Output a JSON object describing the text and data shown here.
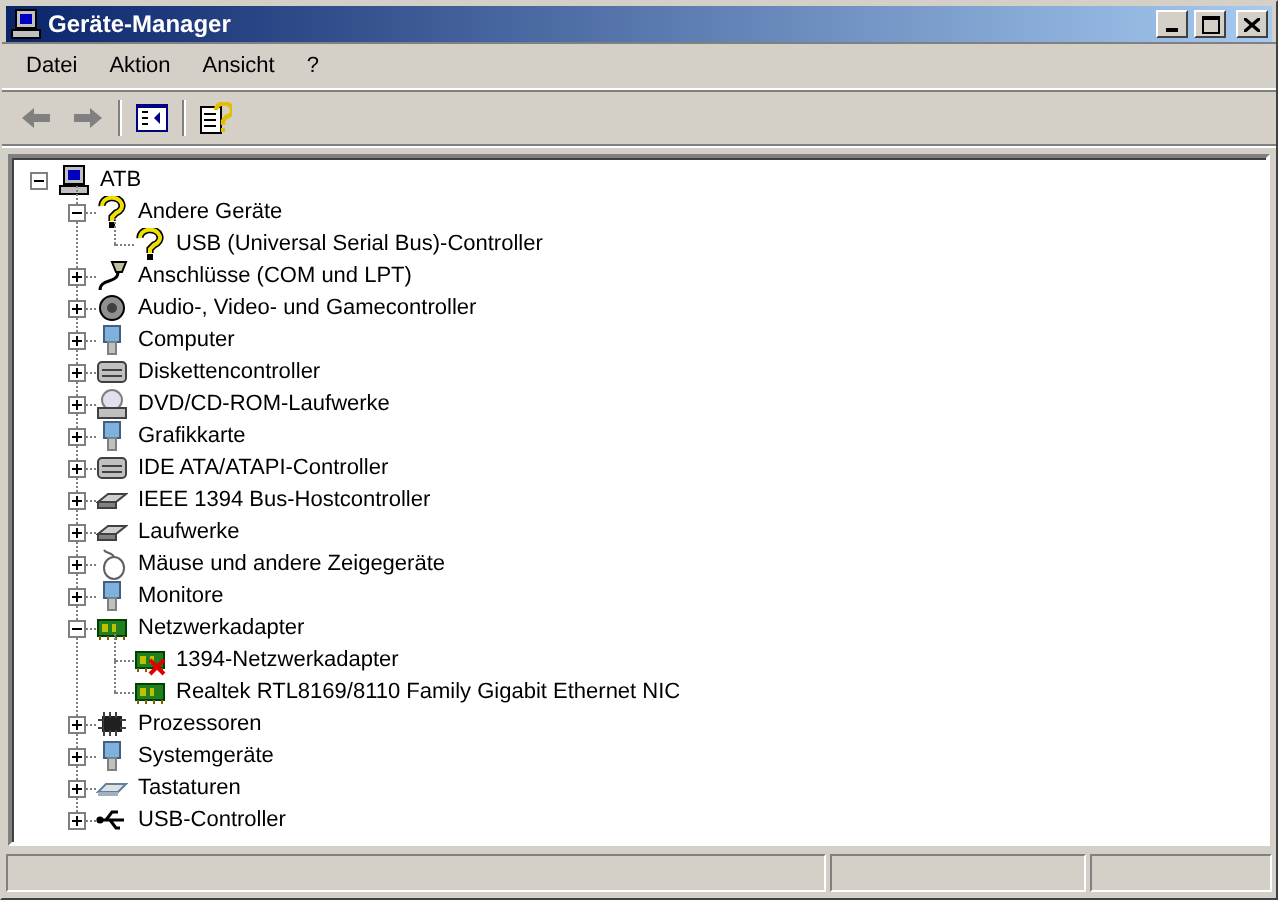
{
  "window": {
    "title": "Geräte-Manager",
    "controls": [
      {
        "kind": "minimize"
      },
      {
        "kind": "maximize"
      },
      {
        "kind": "close"
      }
    ]
  },
  "menu": [
    "Datei",
    "Aktion",
    "Ansicht",
    "?"
  ],
  "toolbar": [
    {
      "kind": "back",
      "disabled": true
    },
    {
      "kind": "forward",
      "disabled": true
    },
    {
      "kind": "tree",
      "disabled": false
    },
    {
      "kind": "properties",
      "disabled": false
    }
  ],
  "tree": {
    "label": "ATB",
    "kind": "computer",
    "expanded": true,
    "children": [
      {
        "label": "Andere Geräte",
        "kind": "unknown",
        "expanded": true,
        "children": [
          {
            "label": "USB (Universal Serial Bus)-Controller",
            "kind": "warning"
          }
        ]
      },
      {
        "label": "Anschlüsse (COM und LPT)",
        "kind": "port",
        "expanded": false
      },
      {
        "label": "Audio-, Video- und Gamecontroller",
        "kind": "audio",
        "expanded": false
      },
      {
        "label": "Computer",
        "kind": "pc",
        "expanded": false
      },
      {
        "label": "Diskettencontroller",
        "kind": "controller",
        "expanded": false
      },
      {
        "label": "DVD/CD-ROM-Laufwerke",
        "kind": "cdrom",
        "expanded": false
      },
      {
        "label": "Grafikkarte",
        "kind": "pc",
        "expanded": false
      },
      {
        "label": "IDE ATA/ATAPI-Controller",
        "kind": "controller",
        "expanded": false
      },
      {
        "label": "IEEE 1394 Bus-Hostcontroller",
        "kind": "drive",
        "expanded": false
      },
      {
        "label": "Laufwerke",
        "kind": "drive",
        "expanded": false
      },
      {
        "label": "Mäuse und andere Zeigegeräte",
        "kind": "mouse",
        "expanded": false
      },
      {
        "label": "Monitore",
        "kind": "pc",
        "expanded": false
      },
      {
        "label": "Netzwerkadapter",
        "kind": "network",
        "expanded": true,
        "children": [
          {
            "label": "1394-Netzwerkadapter",
            "kind": "network",
            "disabled": true
          },
          {
            "label": "Realtek RTL8169/8110 Family Gigabit Ethernet NIC",
            "kind": "network",
            "disabled": false
          }
        ]
      },
      {
        "label": "Prozessoren",
        "kind": "chip",
        "expanded": false
      },
      {
        "label": "Systemgeräte",
        "kind": "pc",
        "expanded": false
      },
      {
        "label": "Tastaturen",
        "kind": "keyboard",
        "expanded": false
      },
      {
        "label": "USB-Controller",
        "kind": "usb",
        "expanded": false
      }
    ]
  },
  "status_bar": {
    "panes": [
      {
        "kind": "wide"
      },
      {
        "kind": "medium"
      },
      {
        "kind": "small"
      }
    ]
  }
}
